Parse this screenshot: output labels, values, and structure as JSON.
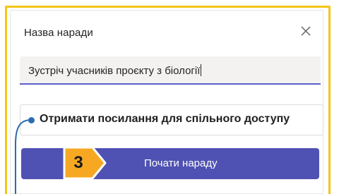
{
  "dialog": {
    "title": "Назва наради",
    "close_icon": "close-icon"
  },
  "meeting_name_input": {
    "value": "Зустріч учасників проєкту з біології"
  },
  "share_link": {
    "label": "Отримати посилання для спільного доступу"
  },
  "start_button": {
    "label": "Почати нараду"
  },
  "step_badge": {
    "number": "3"
  },
  "colors": {
    "frame": "#f5c518",
    "accent": "#4f52b2",
    "input_underline": "#5b5fc7",
    "badge": "#f7a823",
    "pointer": "#2b6cb0"
  }
}
